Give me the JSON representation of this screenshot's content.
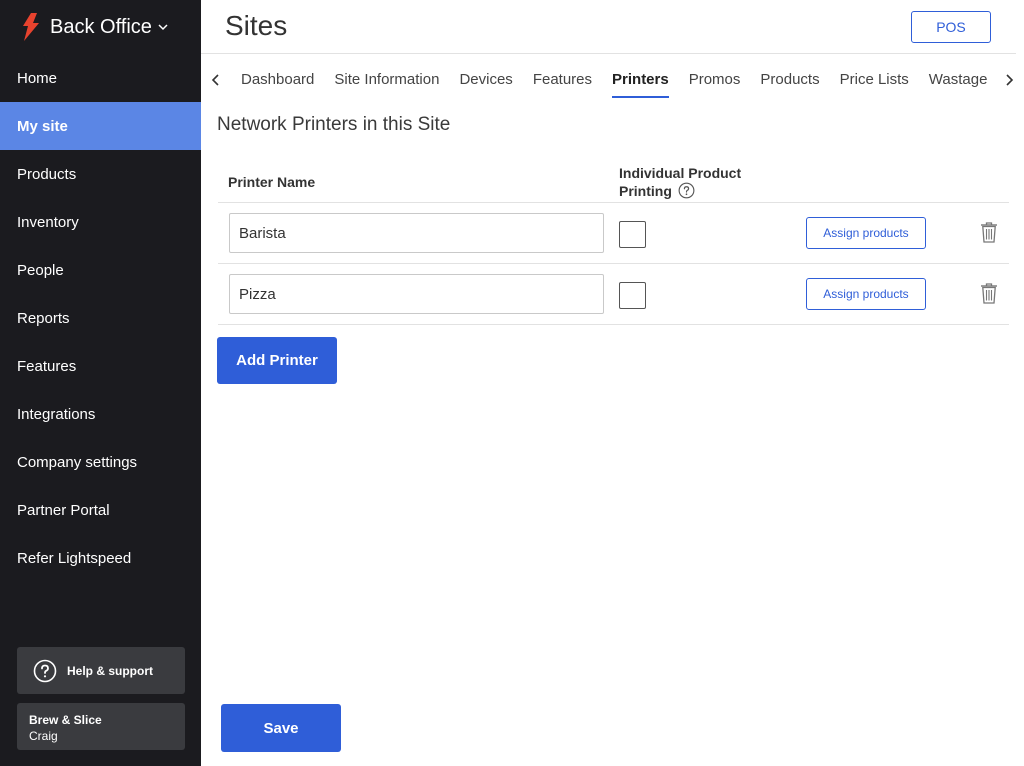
{
  "app": {
    "name": "Back Office"
  },
  "sidebar": {
    "items": [
      {
        "label": "Home"
      },
      {
        "label": "My site",
        "active": true
      },
      {
        "label": "Products"
      },
      {
        "label": "Inventory"
      },
      {
        "label": "People"
      },
      {
        "label": "Reports"
      },
      {
        "label": "Features"
      },
      {
        "label": "Integrations"
      },
      {
        "label": "Company settings"
      },
      {
        "label": "Partner Portal"
      },
      {
        "label": "Refer Lightspeed"
      }
    ],
    "help_label": "Help & support",
    "account": {
      "business": "Brew & Slice",
      "user": "Craig"
    }
  },
  "header": {
    "title": "Sites",
    "pos_label": "POS"
  },
  "tabs": [
    {
      "label": "Dashboard"
    },
    {
      "label": "Site Information"
    },
    {
      "label": "Devices"
    },
    {
      "label": "Features"
    },
    {
      "label": "Printers",
      "active": true
    },
    {
      "label": "Promos"
    },
    {
      "label": "Products"
    },
    {
      "label": "Price Lists"
    },
    {
      "label": "Wastage"
    }
  ],
  "section": {
    "title": "Network Printers in this Site"
  },
  "table": {
    "col_name": "Printer Name",
    "col_ipp": "Individual Product Printing",
    "rows": [
      {
        "name": "Barista",
        "individual_printing": false,
        "assign_label": "Assign products"
      },
      {
        "name": "Pizza",
        "individual_printing": false,
        "assign_label": "Assign products"
      }
    ]
  },
  "actions": {
    "add_label": "Add Printer",
    "save_label": "Save"
  },
  "colors": {
    "accent": "#2f5ed8",
    "sidebar_bg": "#1b1b1f",
    "active_nav": "#5b86e5",
    "brand_red": "#e8432e"
  },
  "icons": [
    "lightspeed-flame-icon",
    "chevron-down-icon",
    "help-circle-icon",
    "chevron-left-icon",
    "chevron-right-icon",
    "info-icon",
    "trash-icon"
  ]
}
